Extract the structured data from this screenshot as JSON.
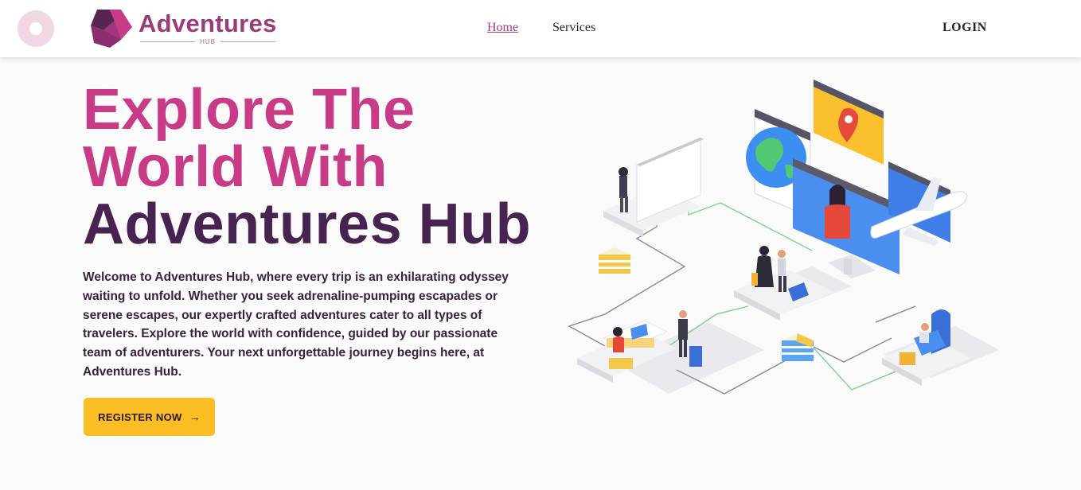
{
  "header": {
    "brand": {
      "name": "Adventures",
      "subtitle": "HUB"
    },
    "nav": [
      {
        "label": "Home",
        "active": true
      },
      {
        "label": "Services",
        "active": false
      }
    ],
    "login_label": "LOGIN"
  },
  "hero": {
    "title_line1": "Explore The",
    "title_line2": "World With",
    "title_line3": "Adventures Hub",
    "description": "Welcome to Adventures Hub, where every trip is an exhilarating odyssey waiting to unfold. Whether you seek adrenaline-pumping escapades or serene escapes, our expertly crafted adventures cater to all types of travelers. Explore the world with confidence, guided by our passionate team of adventurers. Your next unforgettable journey begins here, at Adventures Hub.",
    "cta_label": "REGISTER NOW",
    "cta_icon": "arrow-right-icon"
  },
  "colors": {
    "brand_pink": "#c83b86",
    "brand_purple": "#472350",
    "accent_yellow": "#fbbd24",
    "nav_active": "#a63c82"
  }
}
